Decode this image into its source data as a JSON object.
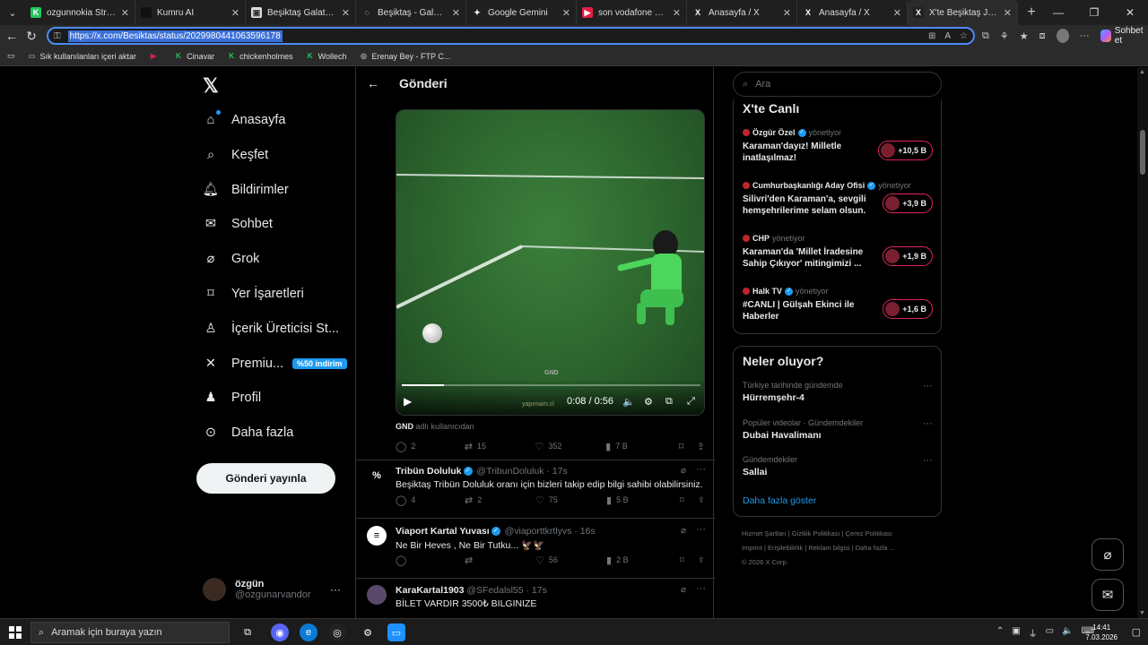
{
  "browser": {
    "tabs": [
      {
        "title": "ozgunnokia Stream - W",
        "fav_color": "#22c55e",
        "fav_glyph": "K"
      },
      {
        "title": "Kumru AI",
        "fav_color": "#111111",
        "fav_glyph": ""
      },
      {
        "title": "Beşiktaş Galatasaray Ma",
        "fav_color": "#dddddd",
        "fav_glyph": "▣"
      },
      {
        "title": "Beşiktaş - Galatasaray D",
        "fav_color": "#1f1f1f",
        "fav_glyph": "◌"
      },
      {
        "title": "Google Gemini",
        "fav_color": "#1f1f1f",
        "fav_glyph": "✦"
      },
      {
        "title": "son vodafone park maç",
        "fav_color": "#e11d48",
        "fav_glyph": "▶"
      },
      {
        "title": "Anasayfa / X",
        "fav_color": "#1f1f1f",
        "fav_glyph": "X"
      },
      {
        "title": "Anasayfa / X",
        "fav_color": "#1f1f1f",
        "fav_glyph": "X"
      },
      {
        "title": "X'te Beşiktaş JK: \"Ne bi",
        "fav_color": "#1f1f1f",
        "fav_glyph": "X"
      }
    ],
    "url": "https://x.com/Besiktas/status/2029980441063596178",
    "copilot_label": "Sohbet et",
    "bookmarks": [
      {
        "label": "Sık kullanılanları içeri aktar",
        "color": "#888888",
        "glyph": "▭"
      },
      {
        "label": "",
        "color": "#e11d48",
        "glyph": "▶"
      },
      {
        "label": "Cinavar",
        "color": "#22c55e",
        "glyph": "K"
      },
      {
        "label": "chickenholmes",
        "color": "#22c55e",
        "glyph": "K"
      },
      {
        "label": "Wollech",
        "color": "#22c55e",
        "glyph": "K"
      },
      {
        "label": "Erenay Bey - FTP C...",
        "color": "#aaaaaa",
        "glyph": "◎"
      }
    ]
  },
  "nav": {
    "items": [
      {
        "label": "Anasayfa",
        "icon": "home-icon"
      },
      {
        "label": "Keşfet",
        "icon": "search-icon"
      },
      {
        "label": "Bildirimler",
        "icon": "bell-icon"
      },
      {
        "label": "Sohbet",
        "icon": "mail-icon"
      },
      {
        "label": "Grok",
        "icon": "grok-icon"
      },
      {
        "label": "Yer İşaretleri",
        "icon": "bookmark-icon"
      },
      {
        "label": "İçerik Üreticisi St...",
        "icon": "creator-icon"
      },
      {
        "label": "Premiu...",
        "icon": "x-icon"
      },
      {
        "label": "Profil",
        "icon": "person-icon"
      },
      {
        "label": "Daha fazla",
        "icon": "more-circle-icon"
      }
    ],
    "premium_badge": "%50 indirim",
    "post_button": "Gönderi yayınla",
    "profile_name": "özgün",
    "profile_handle": "@ozgunarvandor"
  },
  "main": {
    "title": "Gönderi",
    "video": {
      "time": "0:08 / 0:56",
      "progress": 0.14,
      "watermark": "GND",
      "watermark2": "yapımam.cl"
    },
    "caption_name": "GND",
    "caption_rest": " adlı kullanıcıdan",
    "post_stats": {
      "replies": "2",
      "reposts": "15",
      "likes": "352",
      "views": "7 B"
    },
    "replies": [
      {
        "name": "Tribün Doluluk",
        "verified": true,
        "handle": "@TribunDoluluk · 17s",
        "text": "Beşiktaş Tribün Doluluk oranı için bizleri takip edip bilgi sahibi olabilirsiniz.",
        "avatar": "%",
        "avatar_bg": "#000000",
        "replies": "4",
        "reposts": "2",
        "likes": "75",
        "views": "5 B"
      },
      {
        "name": "Viaport Kartal Yuvası",
        "verified": true,
        "handle": "@viaporttkrtlyvs · 16s",
        "text": "Ne Bir Heves , Ne Bir Tutku... 🦅🦅",
        "avatar": "≡",
        "avatar_bg": "#ffffff",
        "replies": "",
        "reposts": "",
        "likes": "56",
        "views": "2 B"
      },
      {
        "name": "KaraKartal1903",
        "verified": false,
        "handle": "@SFedalsl55 · 17s",
        "text": "BİLET VARDIR 3500₺ BILGINIZE",
        "avatar": "",
        "avatar_bg": "#5a4a6a"
      }
    ]
  },
  "right": {
    "search_placeholder": "Ara",
    "live_title": "X'te Canlı",
    "live": [
      {
        "host": "Özgür Özel",
        "verified": true,
        "role": "yönetiyor",
        "title": "Karaman'dayız! Milletle inatlaşılmaz!",
        "count": "+10,5 B"
      },
      {
        "host": "Cumhurbaşkanlığı Aday Ofisi",
        "verified": true,
        "role": "yönetiyor",
        "title": "Silivri'den Karaman'a, sevgili hemşehrilerime selam olsun.",
        "count": "+3,9 B"
      },
      {
        "host": "CHP",
        "verified": false,
        "role": "yönetiyor",
        "title": "Karaman'da 'Millet İradesine Sahip Çıkıyor' mitingimizi ...",
        "count": "+1,9 B"
      },
      {
        "host": "Halk TV",
        "verified": true,
        "role": "yönetiyor",
        "title": "#CANLI | Gülşah Ekinci ile Haberler",
        "count": "+1,6 B"
      }
    ],
    "trends_title": "Neler oluyor?",
    "trends": [
      {
        "context": "Türkiye tarihinde gündemde",
        "topic": "Hürremşehr-4"
      },
      {
        "context": "Popüler videolar · Gündemdekiler",
        "topic": "Dubai Havalimanı"
      },
      {
        "context": "Gündemdekiler",
        "topic": "Sallai"
      }
    ],
    "show_more": "Daha fazla göster",
    "footer": [
      "Hizmet Şartları",
      "Gizlilik Politikası",
      "Çerez Politikası",
      "Imprint",
      "Erişilebilirlik",
      "Reklam bilgisi",
      "Daha fazla ...",
      "© 2026 X Corp."
    ]
  },
  "taskbar": {
    "search_placeholder": "Aramak için buraya yazın",
    "time": "14:41",
    "date": "7.03.2026"
  }
}
